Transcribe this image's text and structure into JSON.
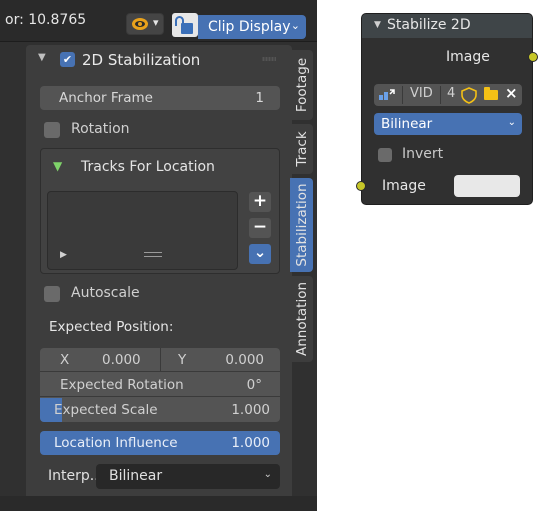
{
  "header": {
    "factor_text": "or: 10.8765",
    "clip_display_label": "Clip Display",
    "colors": {
      "accent": "#4772b3",
      "overlay_icon": "#e9a21b"
    }
  },
  "panel": {
    "title": "2D Stabilization",
    "enabled": true,
    "anchor_frame": {
      "label": "Anchor Frame",
      "value": "1"
    },
    "rotation": {
      "label": "Rotation",
      "checked": false
    },
    "tracks_for_location": {
      "title": "Tracks For Location",
      "buttons": {
        "add": "+",
        "remove": "−",
        "menu": "⌄"
      }
    },
    "autoscale": {
      "label": "Autoscale",
      "checked": false
    },
    "expected_position_title": "Expected Position:",
    "expected_position": {
      "x_label": "X",
      "x_value": "0.000",
      "y_label": "Y",
      "y_value": "0.000"
    },
    "expected_rotation": {
      "label": "Expected Rotation",
      "value": "0°"
    },
    "expected_scale": {
      "label": "Expected Scale",
      "value": "1.000",
      "fill_fraction": 0.09
    },
    "location_influence": {
      "label": "Location Influence",
      "value": "1.000",
      "fill_fraction": 1.0
    },
    "interpolate": {
      "label": "Interp...",
      "value": "Bilinear"
    }
  },
  "tabs": [
    {
      "label": "Footage",
      "active": false
    },
    {
      "label": "Track",
      "active": false
    },
    {
      "label": "Stabilization",
      "active": true
    },
    {
      "label": "Annotation",
      "active": false
    }
  ],
  "node": {
    "title": "Stabilize 2D",
    "output_label": "Image",
    "toolbar": {
      "vid": "VID",
      "users": "4",
      "close": "×"
    },
    "filter": "Bilinear",
    "invert": {
      "label": "Invert",
      "checked": false
    },
    "input_label": "Image",
    "socket_color": "#c7c729"
  }
}
